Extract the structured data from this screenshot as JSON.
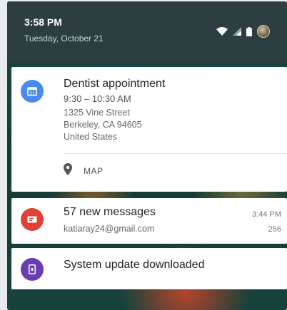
{
  "status_bar": {
    "time": "3:58 PM",
    "date": "Tuesday, October 21"
  },
  "notifications": [
    {
      "app_icon": "calendar-icon",
      "icon_color": "#4a89f1",
      "title": "Dentist appointment",
      "lines": [
        "9:30 – 10:30 AM",
        "1325 Vine Street",
        "Berkeley, CA 94605",
        "United States"
      ],
      "action": {
        "icon": "location-pin-icon",
        "label": "MAP"
      }
    },
    {
      "app_icon": "email-icon",
      "icon_color": "#df4136",
      "title": "57 new messages",
      "subtitle": "katiaray24@gmail.com",
      "time": "3:44 PM",
      "count": "256"
    },
    {
      "app_icon": "system-update-icon",
      "icon_color": "#6a3db3",
      "title": "System update downloaded"
    }
  ]
}
